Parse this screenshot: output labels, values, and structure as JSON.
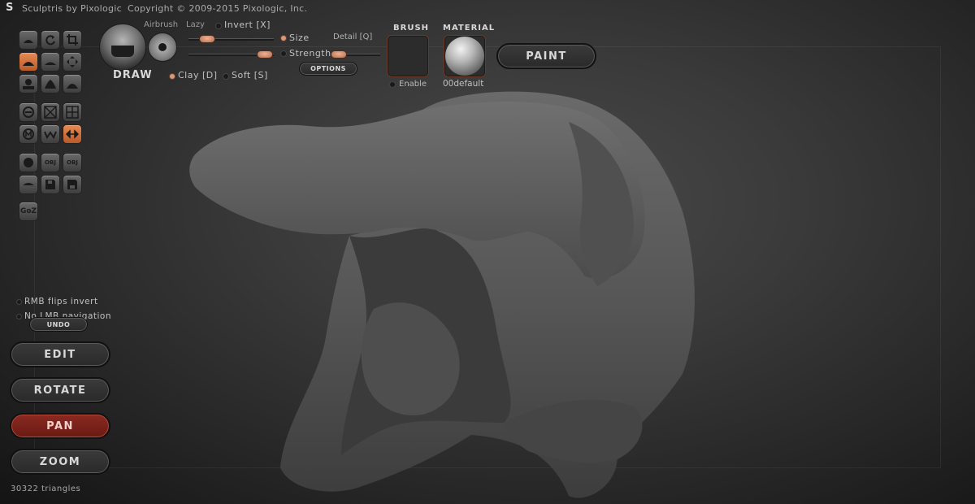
{
  "titlebar": {
    "app_name": "Sculptris by Pixologic",
    "copyright": "Copyright © 2009-2015 Pixologic, Inc."
  },
  "brush": {
    "current_name": "DRAW",
    "airbrush_label": "Airbrush",
    "lazy_label": "Lazy",
    "invert_label": "Invert [X]",
    "size_label": "Size",
    "detail_label": "Detail [Q]",
    "strength_label": "Strength",
    "clay_label": "Clay [D]",
    "soft_label": "Soft [S]",
    "options_button": "OPTIONS",
    "size_selected": true,
    "clay_selected": true
  },
  "brush_panel": {
    "heading": "BRUSH",
    "enable_label": "Enable"
  },
  "material_panel": {
    "heading": "MATERIAL",
    "material_name": "00default"
  },
  "paint_button": "PAINT",
  "toolbar_icons": [
    "draw-icon",
    "rotate-icon",
    "crop-icon",
    "crease-icon",
    "flatten-icon",
    "move-arrows-icon",
    "inflate-icon",
    "pinch-icon",
    "smooth-icon",
    "symmetry-icon",
    "wireframe-icon",
    "grid-icon",
    "mask-icon",
    "pattern-icon",
    "reduce-icon",
    "sphere-icon",
    "import-obj-icon",
    "export-obj-icon",
    "plane-icon",
    "save-icon",
    "load-icon",
    "goz-icon"
  ],
  "toolbar_text": {
    "import_obj": "OBJ",
    "export_obj": "OBJ",
    "goz": "GoZ"
  },
  "options": {
    "rmb_flips_invert": "RMB flips invert",
    "no_lmb_navigation": "No LMB navigation"
  },
  "nav": {
    "undo": "UNDO",
    "edit": "EDIT",
    "rotate": "ROTATE",
    "pan": "PAN",
    "zoom": "ZOOM",
    "active": "PAN"
  },
  "status": {
    "triangles": "30322 triangles"
  },
  "colors": {
    "accent": "#d06a36",
    "active_nav": "#7a2018",
    "slider_knob": "#d99272"
  }
}
